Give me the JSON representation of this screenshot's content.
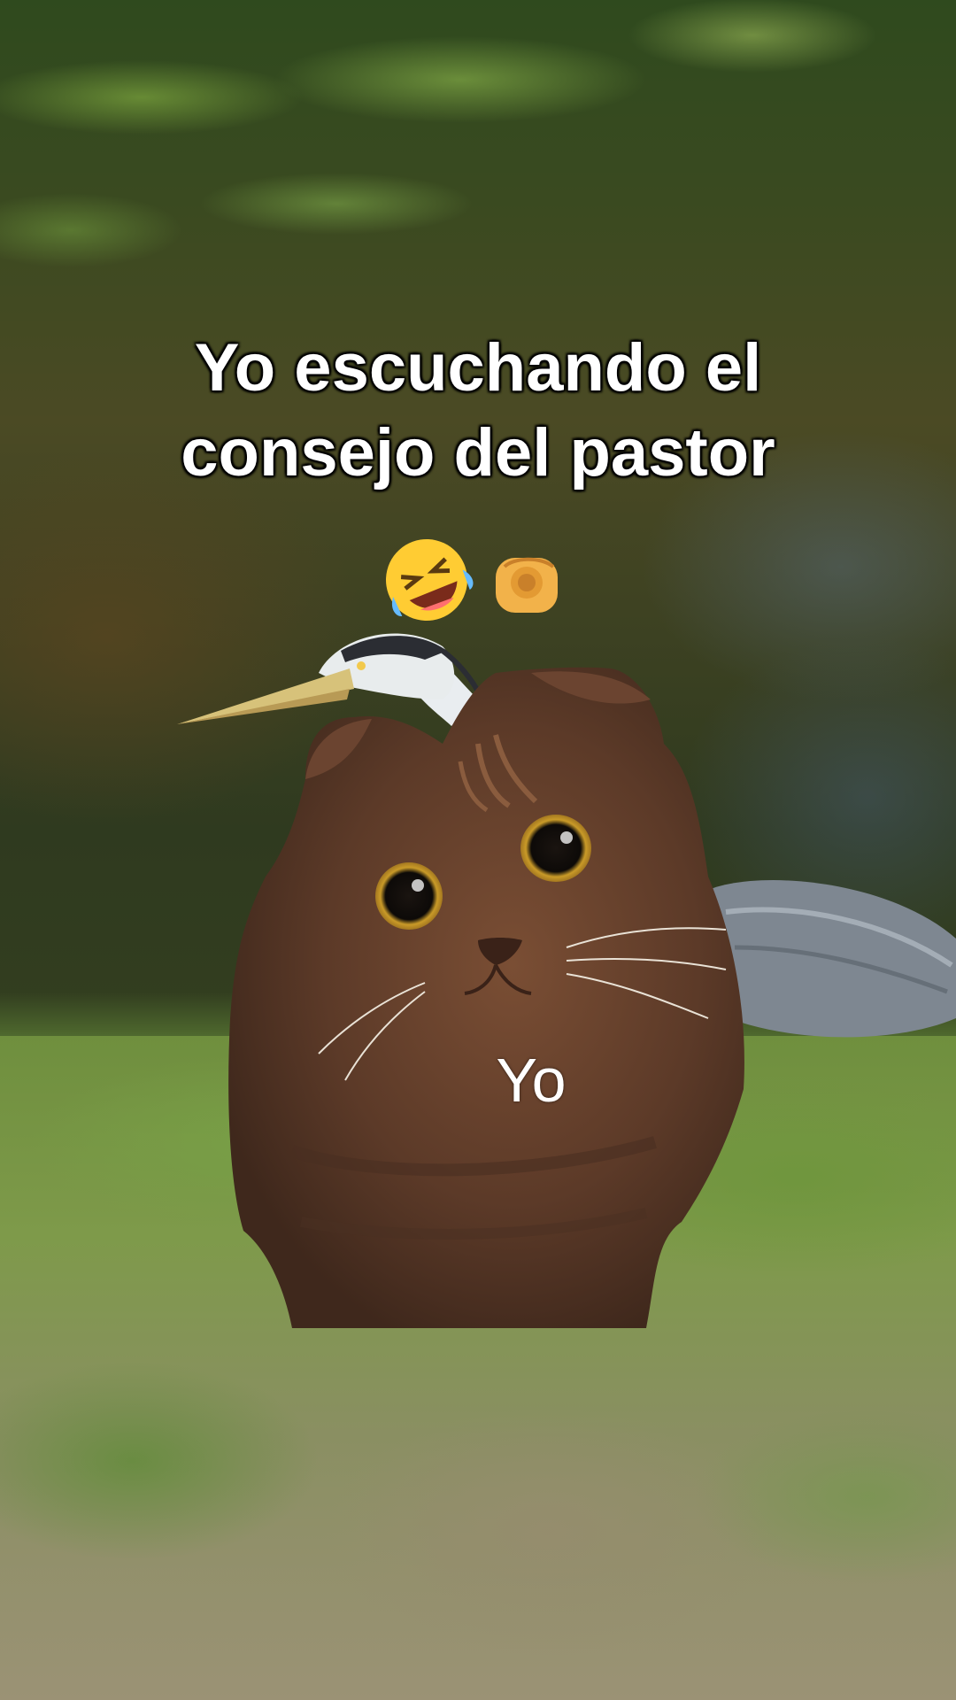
{
  "caption": {
    "line1": "Yo escuchando el",
    "line2": "consejo del pastor"
  },
  "emojis": [
    "rolling-on-floor-laughing-emoji",
    "backhand-index-pointing-at-viewer-emoji"
  ],
  "cat_label": "Yo",
  "scene": {
    "background": "pond-with-duckweed-and-grass",
    "subjects": [
      "heron-icon",
      "cat-cutout"
    ]
  },
  "colors": {
    "caption_text": "#ffffff",
    "water": "#3e4222",
    "cat_fur": "#5a3a28"
  }
}
